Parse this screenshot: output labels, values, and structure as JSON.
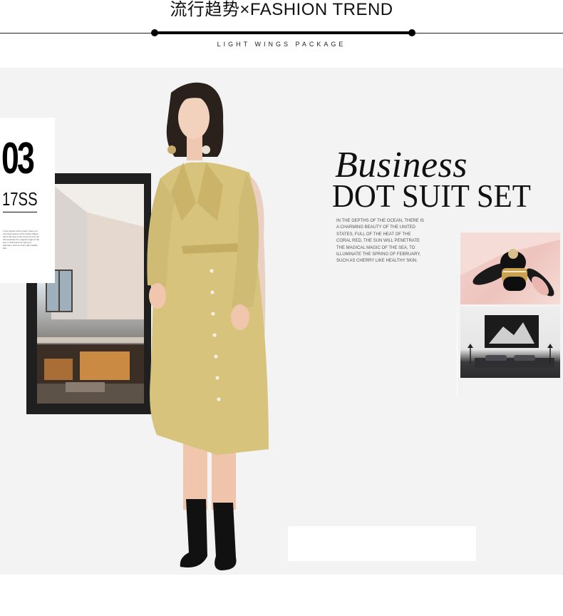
{
  "header": {
    "title": "流行趋势×FASHION TREND",
    "subtitle": "LIGHT WINGS PACKAGE"
  },
  "card": {
    "number": "03",
    "season": "17SS",
    "fine_print": "In the depths of the ocean, there is a charming beauty of the United States, full of the heat of the coral red, the sun will penetrate the magical magic of the sea, to illuminate the spring of February, such as cherry like healthy skin."
  },
  "headline": {
    "script": "Business",
    "main": "DOT SUIT SET"
  },
  "body_copy": "IN THE DEPTHS OF THE OCEAN, THERE IS A CHARMING BEAUTY OF THE UNITED STATES, FULL OF THE HEAT OF THE CORAL RED, THE SUN WILL PENETRATE THE MAGICAL MAGIC OF THE SEA, TO ILLUMINATE THE SPRING OF FEBRUARY, SUCH AS CHERRY LIKE HEALTHY SKIN.",
  "colors": {
    "panel": "#f3f3f3",
    "dress": "#d7c37c",
    "frame": "#1f1f1f",
    "pink": "#f0c9c2"
  }
}
